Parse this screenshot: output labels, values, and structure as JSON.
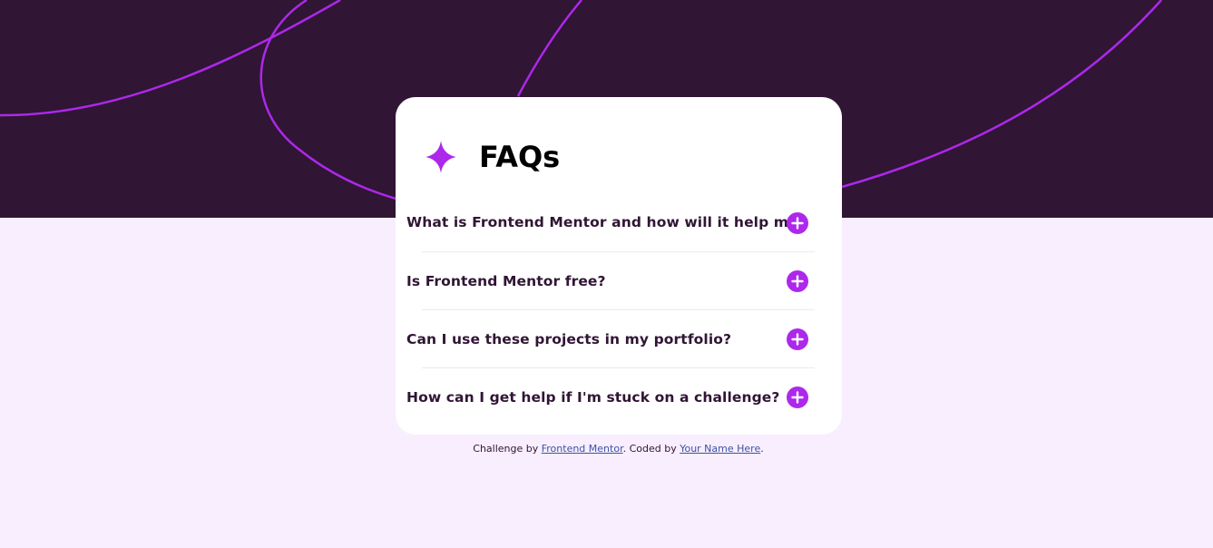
{
  "colors": {
    "background": "#f8eefe",
    "hero_background": "#301534",
    "hero_curve": "#ad28eb",
    "accent": "#ad28eb",
    "card": "#ffffff",
    "question_text": "#301534",
    "link": "#3e52a3"
  },
  "header": {
    "icon": "star-icon",
    "title": "FAQs"
  },
  "faqs": [
    {
      "question": "What is Frontend Mentor and how will it help me?",
      "expanded": false,
      "icon": "plus-icon"
    },
    {
      "question": "Is Frontend Mentor free?",
      "expanded": false,
      "icon": "plus-icon"
    },
    {
      "question": "Can I use these projects in my portfolio?",
      "expanded": false,
      "icon": "plus-icon"
    },
    {
      "question": "How can I get help if I'm stuck on a challenge?",
      "expanded": false,
      "icon": "plus-icon"
    }
  ],
  "attribution": {
    "prefix": "Challenge by ",
    "challenge_link": "Frontend Mentor",
    "middle": ". Coded by ",
    "author_link": "Your Name Here",
    "suffix": "."
  }
}
